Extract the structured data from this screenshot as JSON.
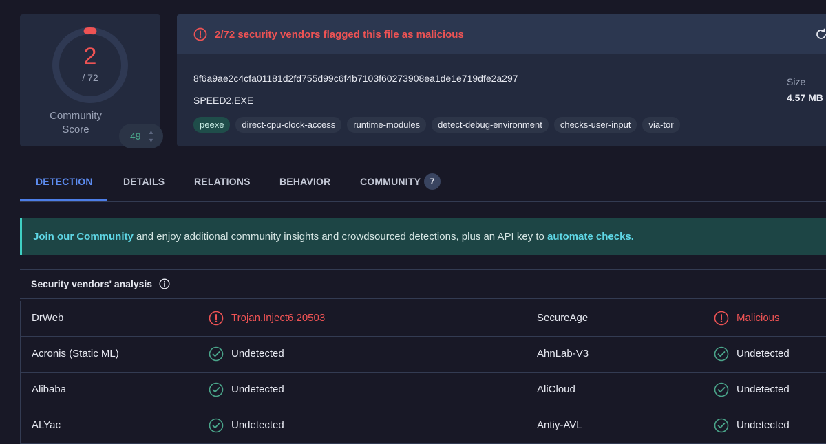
{
  "score": {
    "detections": "2",
    "total": "/ 72",
    "community_label": "Community Score",
    "community_value": "49",
    "detection_fraction": 0.0278,
    "accent_color": "#ee5354"
  },
  "alert": {
    "text": "2/72 security vendors flagged this file as malicious",
    "icon": "alert-circle-icon"
  },
  "file": {
    "hash": "8f6a9ae2c4cfa01181d2fd755d99c6f4b7103f60273908ea1de1e719dfe2a297",
    "name": "SPEED2.EXE",
    "size_label": "Size",
    "size_value": "4.57 MB",
    "tags": [
      "peexe",
      "direct-cpu-clock-access",
      "runtime-modules",
      "detect-debug-environment",
      "checks-user-input",
      "via-tor"
    ]
  },
  "tabs": [
    {
      "label": "DETECTION",
      "active": true
    },
    {
      "label": "DETAILS"
    },
    {
      "label": "RELATIONS"
    },
    {
      "label": "BEHAVIOR"
    },
    {
      "label": "COMMUNITY",
      "badge": "7"
    }
  ],
  "banner": {
    "link1": "Join our Community",
    "middle": " and enjoy additional community insights and crowdsourced detections, plus an API key to ",
    "link2": "automate checks."
  },
  "vendors": {
    "title": "Security vendors' analysis",
    "rows": [
      {
        "left_name": "DrWeb",
        "left_result": "Trojan.Inject6.20503",
        "left_status": "malicious",
        "right_name": "SecureAge",
        "right_result": "Malicious",
        "right_status": "malicious"
      },
      {
        "left_name": "Acronis (Static ML)",
        "left_result": "Undetected",
        "left_status": "clean",
        "right_name": "AhnLab-V3",
        "right_result": "Undetected",
        "right_status": "clean"
      },
      {
        "left_name": "Alibaba",
        "left_result": "Undetected",
        "left_status": "clean",
        "right_name": "AliCloud",
        "right_result": "Undetected",
        "right_status": "clean"
      },
      {
        "left_name": "ALYac",
        "left_result": "Undetected",
        "left_status": "clean",
        "right_name": "Antiy-AVL",
        "right_result": "Undetected",
        "right_status": "clean"
      }
    ]
  }
}
